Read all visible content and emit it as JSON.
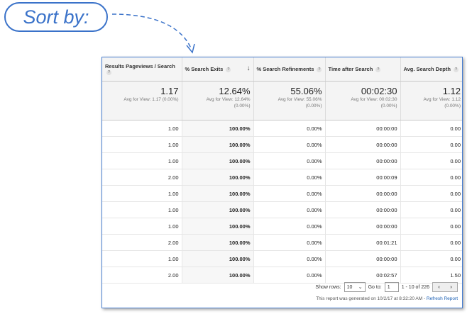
{
  "callout": {
    "label": "Sort by:"
  },
  "columns": [
    {
      "label": "Results Pageviews / Search",
      "help": "?"
    },
    {
      "label": "% Search Exits",
      "help": "?",
      "sort_indicator": "↓"
    },
    {
      "label": "% Search Refinements",
      "help": "?"
    },
    {
      "label": "Time after Search",
      "help": "?"
    },
    {
      "label": "Avg. Search Depth",
      "help": "?"
    }
  ],
  "summary": [
    {
      "value": "1.17",
      "avg": "Avg for View: 1.17 (0.00%)"
    },
    {
      "value": "12.64%",
      "avg": "Avg for View: 12.64%",
      "avg2": "(0.00%)"
    },
    {
      "value": "55.06%",
      "avg": "Avg for View: 55.06%",
      "avg2": "(0.00%)"
    },
    {
      "value": "00:02:30",
      "avg": "Avg for View: 00:02:30",
      "avg2": "(0.00%)"
    },
    {
      "value": "1.12",
      "avg": "Avg for View: 1.12",
      "avg2": "(0.00%)"
    }
  ],
  "rows": [
    [
      "1.00",
      "100.00%",
      "0.00%",
      "00:00:00",
      "0.00"
    ],
    [
      "1.00",
      "100.00%",
      "0.00%",
      "00:00:00",
      "0.00"
    ],
    [
      "1.00",
      "100.00%",
      "0.00%",
      "00:00:00",
      "0.00"
    ],
    [
      "2.00",
      "100.00%",
      "0.00%",
      "00:00:09",
      "0.00"
    ],
    [
      "1.00",
      "100.00%",
      "0.00%",
      "00:00:00",
      "0.00"
    ],
    [
      "1.00",
      "100.00%",
      "0.00%",
      "00:00:00",
      "0.00"
    ],
    [
      "1.00",
      "100.00%",
      "0.00%",
      "00:00:00",
      "0.00"
    ],
    [
      "2.00",
      "100.00%",
      "0.00%",
      "00:01:21",
      "0.00"
    ],
    [
      "1.00",
      "100.00%",
      "0.00%",
      "00:00:00",
      "0.00"
    ],
    [
      "2.00",
      "100.00%",
      "0.00%",
      "00:02:57",
      "1.50"
    ]
  ],
  "footer": {
    "show_rows_label": "Show rows:",
    "show_rows_value": "10",
    "goto_label": "Go to:",
    "goto_value": "1",
    "range": "1 - 10 of 226",
    "prev": "‹",
    "next": "›",
    "generated": "This report was generated on 10/2/17 at 8:32:20 AM - ",
    "refresh": "Refresh Report"
  },
  "colors": {
    "accent": "#3a72c9",
    "link": "#1a5fb4"
  }
}
